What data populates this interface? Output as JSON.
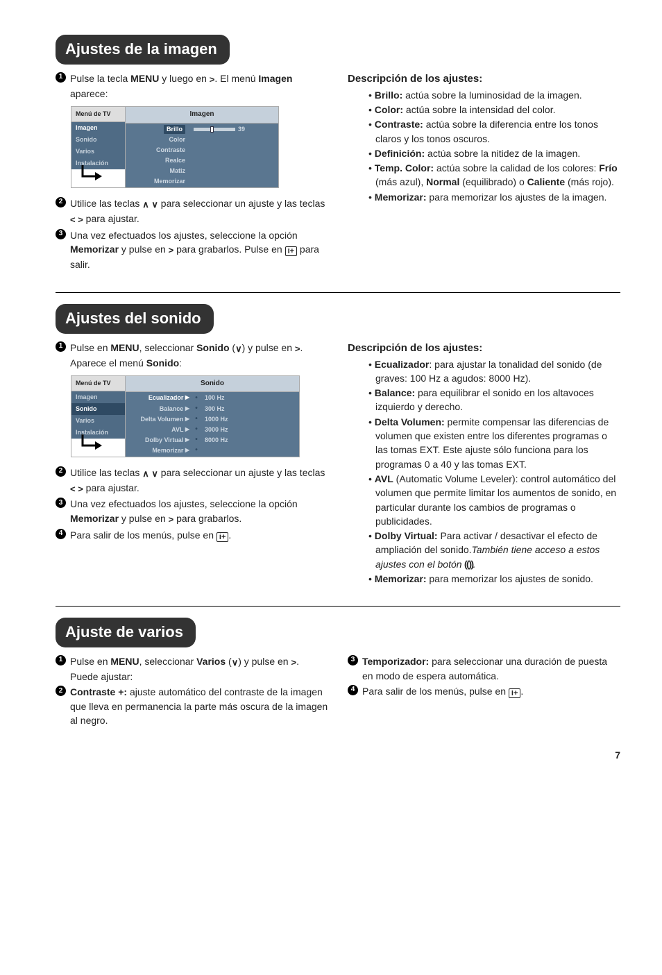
{
  "s1": {
    "title": "Ajustes de la imagen",
    "step1_a": "Pulse la tecla ",
    "step1_b": "MENU",
    "step1_c": " y luego en ",
    "step1_d": ". El menú ",
    "step1_e": "Imagen",
    "step1_f": " aparece:",
    "menu": {
      "side_header": "Menú de TV",
      "side_items": [
        "Imagen",
        "Sonido",
        "Varios",
        "Instalación"
      ],
      "main_header": "Imagen",
      "items": [
        "Brillo",
        "Color",
        "Contraste",
        "Realce",
        "Matiz",
        "Memorizar"
      ],
      "value": "39"
    },
    "step2_a": "Utilice las teclas ",
    "step2_b": " para seleccionar un ajuste y las teclas ",
    "step2_c": " para ajustar.",
    "step3_a": "Una vez efectuados los ajustes, seleccione la opción ",
    "step3_b": "Memorizar",
    "step3_c": " y pulse en ",
    "step3_d": " para grabarlos. Pulse en ",
    "step3_e": " para salir.",
    "desc_title": "Descripción de los ajustes:",
    "desc": [
      {
        "l": "Brillo:",
        "t": " actúa sobre la luminosidad de la imagen."
      },
      {
        "l": "Color:",
        "t": " actúa sobre la intensidad del color."
      },
      {
        "l": "Contraste:",
        "t": " actúa sobre la diferencia entre los tonos claros y los tonos oscuros."
      },
      {
        "l": "Definición:",
        "t": " actúa sobre la nitidez de la imagen."
      },
      {
        "l": "Temp. Color:",
        "t": " actúa sobre la calidad de los colores: ",
        "l2": "Frío",
        "t2": " (más azul), ",
        "l3": "Normal",
        "t3": " (equilibrado) o ",
        "l4": "Caliente",
        "t4": " (más rojo)."
      },
      {
        "l": "Memorizar:",
        "t": " para memorizar los ajustes de la imagen."
      }
    ]
  },
  "s2": {
    "title": "Ajustes del sonido",
    "step1_a": "Pulse en ",
    "step1_b": "MENU",
    "step1_c": ", seleccionar ",
    "step1_d": "Sonido",
    "step1_e": " (",
    "step1_f": ") y pulse en ",
    "step1_g": ". Aparece el menú ",
    "step1_h": "Sonido",
    "step1_i": ":",
    "menu": {
      "side_header": "Menú de TV",
      "side_items": [
        "Imagen",
        "Sonido",
        "Varios",
        "Instalación"
      ],
      "main_header": "Sonido",
      "rows": [
        {
          "name": "Ecualizador",
          "val": "100 Hz"
        },
        {
          "name": "Balance",
          "val": "300 Hz"
        },
        {
          "name": "Delta Volumen",
          "val": "1000 Hz"
        },
        {
          "name": "AVL",
          "val": "3000 Hz"
        },
        {
          "name": "Dolby Virtual",
          "val": "8000 Hz"
        },
        {
          "name": "Memorizar",
          "val": ""
        }
      ]
    },
    "step2_a": "Utilice las teclas ",
    "step2_b": " para seleccionar un ajuste y las teclas ",
    "step2_c": " para ajustar.",
    "step3_a": "Una vez efectuados los ajustes, seleccione la opción ",
    "step3_b": "Memorizar",
    "step3_c": " y pulse en ",
    "step3_d": " para grabarlos.",
    "step4_a": "Para salir de los menús, pulse en ",
    "step4_b": ".",
    "desc_title": "Descripción de los ajustes:",
    "desc": [
      {
        "l": "Ecualizador",
        "t": ": para ajustar la tonalidad del sonido (de graves: 100 Hz a agudos: 8000 Hz)."
      },
      {
        "l": "Balance:",
        "t": " para equilibrar el sonido en los altavoces izquierdo y derecho."
      },
      {
        "l": "Delta Volumen:",
        "t": " permite compensar las diferencias de volumen que existen entre los diferentes programas o las tomas EXT. Este ajuste sólo funciona para los programas 0 a 40 y las tomas EXT."
      },
      {
        "l": "AVL",
        "t": " (Automatic Volume Leveler): control automático del volumen que permite limitar los aumentos de sonido, en particular durante los cambios de programas o publicidades."
      },
      {
        "l": "Dolby Virtual:",
        "t": " Para activar / desactivar el efecto de ampliación del sonido.",
        "it": "También tiene acceso a estos ajustes con el botón ",
        "it2": "."
      },
      {
        "l": "Memorizar:",
        "t": " para memorizar los ajustes de sonido."
      }
    ]
  },
  "s3": {
    "title": "Ajuste de varios",
    "step1_a": "Pulse en ",
    "step1_b": "MENU",
    "step1_c": ", seleccionar ",
    "step1_d": "Varios",
    "step1_e": " (",
    "step1_f": ") y pulse en ",
    "step1_g": ". Puede ajustar:",
    "step2_l": "Contraste +:",
    "step2_t": " ajuste automático del contraste de la imagen que lleva en permanencia la parte más oscura de la imagen al negro.",
    "step3_l": "Temporizador:",
    "step3_t": " para seleccionar una duración de puesta en modo de espera automática.",
    "step4_a": "Para salir de los menús, pulse en ",
    "step4_b": "."
  },
  "page_num": "7",
  "glyphs": {
    "right": "≥",
    "updown": "∧ ∨",
    "leftright": "< >",
    "down": "∨",
    "info": "i+",
    "sound": "⟆⟅"
  }
}
